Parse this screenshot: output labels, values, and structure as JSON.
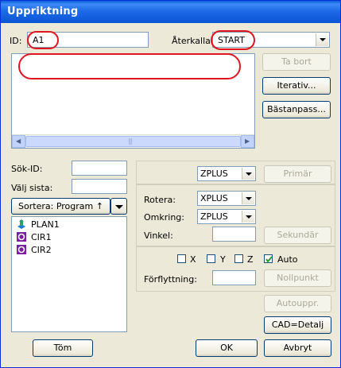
{
  "window": {
    "title": "Uppriktning"
  },
  "top": {
    "id_label": "ID:",
    "id_value": "A1",
    "recall_label": "Återkalla:",
    "recall_value": "START"
  },
  "right_buttons": {
    "delete": "Ta bort",
    "iterative": "Iterativ...",
    "bestfit": "Bästanpass..."
  },
  "search": {
    "id_label": "Sök-ID:",
    "select_last_label": "Välj sista:",
    "sort_label": "Sortera: Program ↑"
  },
  "features": [
    {
      "name": "PLAN1",
      "icon": "plane-icon"
    },
    {
      "name": "CIR1",
      "icon": "circle-icon"
    },
    {
      "name": "CIR2",
      "icon": "circle-icon"
    }
  ],
  "level": {
    "axis": "ZPLUS",
    "button": "Primär"
  },
  "rotate": {
    "rotate_label": "Rotera:",
    "rotate_value": "XPLUS",
    "around_label": "Omkring:",
    "around_value": "ZPLUS",
    "angle_label": "Vinkel:",
    "button": "Sekundär"
  },
  "origin": {
    "x_label": "X",
    "y_label": "Y",
    "z_label": "Z",
    "auto_label": "Auto",
    "move_label": "Förflyttning:",
    "button": "Nollpunkt"
  },
  "lower_buttons": {
    "autoupp": "Autouppr.",
    "cad": "CAD=Detalj"
  },
  "bottom_buttons": {
    "clear": "Töm",
    "ok": "OK",
    "cancel": "Avbryt"
  },
  "colors": {
    "title_bar": "#0a5fd8",
    "annotation_red": "#e0141e",
    "disabled_text": "#aca899"
  }
}
